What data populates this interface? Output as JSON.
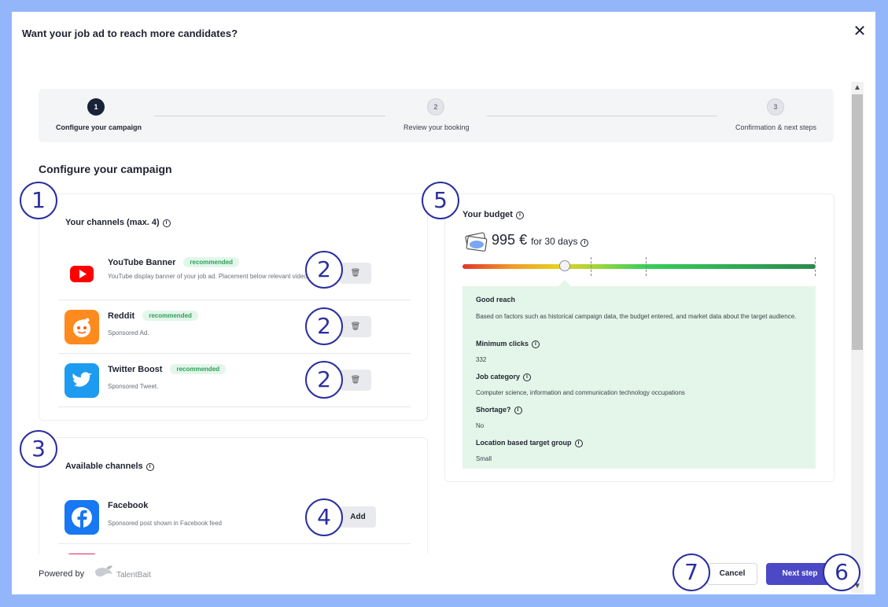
{
  "modal": {
    "title": "Want your job ad to reach more candidates?",
    "close_label": "✕"
  },
  "stepper": {
    "steps": [
      {
        "number": "1",
        "label": "Configure your campaign",
        "state": "active"
      },
      {
        "number": "2",
        "label": "Review your booking",
        "state": "upcoming"
      },
      {
        "number": "3",
        "label": "Confirmation & next steps",
        "state": "upcoming"
      }
    ]
  },
  "section_title": "Configure your campaign",
  "your_channels": {
    "title": "Your channels (max. 4)",
    "items": [
      {
        "name": "YouTube Banner",
        "badge": "recommended",
        "description": "YouTube display banner of your job ad. Placement below relevant videos.",
        "icon": "youtube-icon"
      },
      {
        "name": "Reddit",
        "badge": "recommended",
        "description": "Sponsored Ad.",
        "icon": "reddit-icon"
      },
      {
        "name": "Twitter Boost",
        "badge": "recommended",
        "description": "Sponsored Tweet.",
        "icon": "twitter-icon"
      }
    ],
    "delete_label": "🗑"
  },
  "available_channels": {
    "title": "Available channels",
    "items": [
      {
        "name": "Facebook",
        "description": "Sponsored post shown in Facebook feed",
        "icon": "facebook-icon"
      }
    ],
    "add_label": "Add"
  },
  "budget": {
    "title": "Your budget",
    "amount": "995",
    "currency": "€",
    "duration": "for 30 days",
    "slider_level": 0.29,
    "reach": {
      "title": "Good reach",
      "description": "Based on factors such as historical campaign data, the budget entered, and market data about the target audience.",
      "min_clicks_label": "Minimum clicks",
      "min_clicks_value": "332",
      "job_category_label": "Job category",
      "job_category_value": "Computer science, information and communication technology occupations",
      "shortage_label": "Shortage?",
      "shortage_value": "No",
      "location_label": "Location based target group",
      "location_value": "Small"
    }
  },
  "footer": {
    "powered_by": "Powered by",
    "brand": "TalentBait",
    "cancel_label": "Cancel",
    "next_label": "Next step"
  },
  "annotations": {
    "a1": "1",
    "a2": "2",
    "a3": "3",
    "a4": "4",
    "a5": "5",
    "a6": "6",
    "a7": "7"
  },
  "colors": {
    "accent": "#4b49c6",
    "annotation": "#2a2f9e",
    "background": "#93b6fb",
    "badge_bg": "#e3f6ea",
    "reach_bg": "#e4f6e9"
  }
}
